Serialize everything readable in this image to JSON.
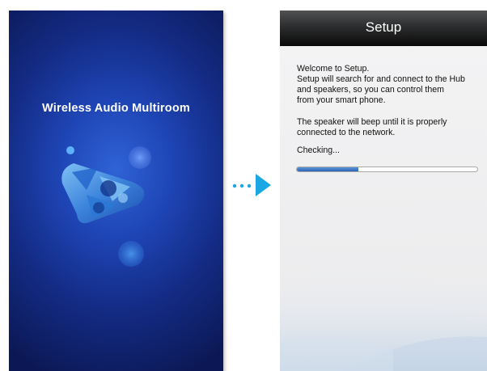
{
  "splash": {
    "app_title": "Wireless Audio Multiroom",
    "logo_icon": "play-triangle-logo-icon",
    "background_color": "#1e44b4"
  },
  "transition": {
    "icon": "dotted-arrow-right-icon",
    "color": "#1aa7e4"
  },
  "setup": {
    "header_title": "Setup",
    "paragraph1": [
      "Welcome to Setup.",
      "Setup will search for and connect to the Hub",
      "and speakers, so you can control them",
      "from your smart phone."
    ],
    "paragraph2": [
      "The speaker will beep until it is properly",
      "connected to the network."
    ],
    "status_text": "Checking...",
    "progress_percent": 34,
    "progress_color": "#2b62b4"
  }
}
